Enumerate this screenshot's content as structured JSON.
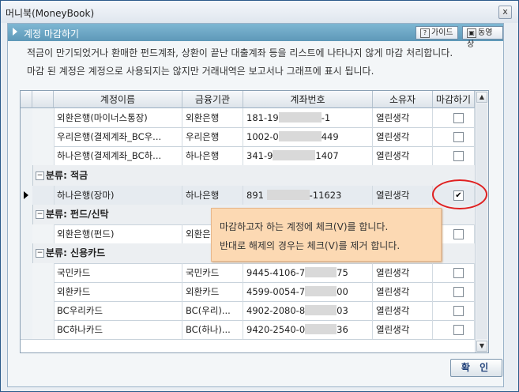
{
  "window": {
    "title": "머니북(MoneyBook)",
    "close": "x"
  },
  "header": {
    "title": "계정 마감하기",
    "guide_label": "가이드",
    "video_label": "동영상"
  },
  "description": [
    "적금이 만기되었거나 환매한 펀드계좌, 상환이 끝난 대출계좌 등을 리스트에 나타나지 않게 마감 처리합니다.",
    "마감 된 계정은 계정으로 사용되지는 않지만 거래내역은 보고서나 그래프에 표시 됩니다."
  ],
  "table": {
    "headers": [
      "계정이름",
      "금융기관",
      "계좌번호",
      "소유자",
      "마감하기"
    ],
    "rows": [
      {
        "name": "외환은행(마이너스통장)",
        "inst": "외환은행",
        "acct_pre": "181-19",
        "acct_post": "-1",
        "owner": "열린생각",
        "checked": false
      },
      {
        "name": "우리은행(결제계좌_BC우...",
        "inst": "우리은행",
        "acct_pre": "1002-0",
        "acct_post": "449",
        "owner": "열린생각",
        "checked": false
      },
      {
        "name": "하나은행(결제계좌_BC하...",
        "inst": "하나은행",
        "acct_pre": "341-9",
        "acct_post": "1407",
        "owner": "열린생각",
        "checked": false
      }
    ],
    "group_savings": "분류: 적금",
    "savings_row": {
      "name": "하나은행(장마)",
      "inst": "하나은행",
      "acct_pre": "891",
      "acct_post": "-11623",
      "owner": "열린생각",
      "checked": true,
      "check_mark": "✔"
    },
    "group_fund": "분류: 펀드/신탁",
    "fund_row": {
      "name": "외환은행(펀드)",
      "inst": "외환은행",
      "checked": false
    },
    "group_card": "분류: 신용카드",
    "card_rows": [
      {
        "name": "국민카드",
        "inst": "국민카드",
        "acct_pre": "9445-4106-7",
        "acct_post": "75",
        "owner": "열린생각",
        "checked": false
      },
      {
        "name": "외환카드",
        "inst": "외환카드",
        "acct_pre": "4599-0054-7",
        "acct_post": "00",
        "owner": "열린생각",
        "checked": false
      },
      {
        "name": "BC우리카드",
        "inst": "BC(우리)...",
        "acct_pre": "4902-2080-8",
        "acct_post": "03",
        "owner": "열린생각",
        "checked": false
      },
      {
        "name": "BC하나카드",
        "inst": "BC(하나)...",
        "acct_pre": "9420-2540-0",
        "acct_post": "36",
        "owner": "열린생각",
        "checked": false
      }
    ],
    "toggle_symbol": "−"
  },
  "tooltip": {
    "line1": "마감하고자 하는 계정에 체크(V)를 합니다.",
    "line2": "반대로 해제의 경우는 체크(V)를 제거 합니다."
  },
  "ok_button": "확 인",
  "scroll": {
    "up": "▲",
    "down": "▼"
  },
  "colors": {
    "header_bg": "#6aa6c6",
    "tooltip_bg": "#fcd9b3",
    "highlight_circle": "#e02020"
  }
}
